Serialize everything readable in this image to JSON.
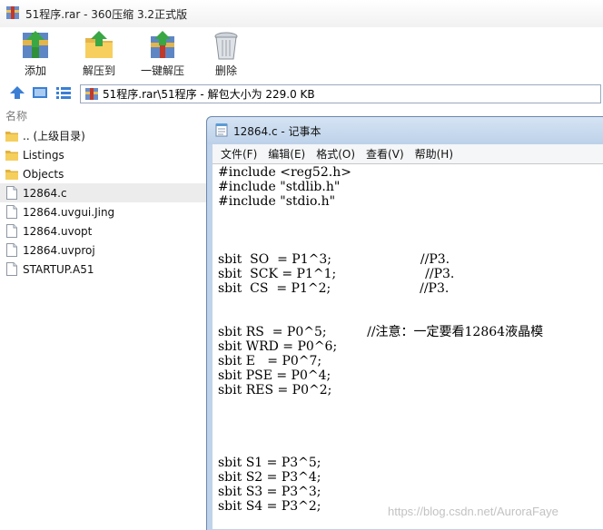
{
  "window": {
    "title": "51程序.rar - 360压缩 3.2正式版"
  },
  "toolbar": [
    {
      "label": "添加",
      "icon": "add-archive-icon"
    },
    {
      "label": "解压到",
      "icon": "extract-folder-icon"
    },
    {
      "label": "一键解压",
      "icon": "one-click-extract-icon"
    },
    {
      "label": "删除",
      "icon": "trash-icon"
    }
  ],
  "navbar": {
    "path": "51程序.rar\\51程序 - 解包大小为 229.0 KB",
    "icons": [
      "up-arrow-icon",
      "view-large-icon",
      "view-list-icon"
    ]
  },
  "filelist": {
    "header": "名称",
    "items": [
      {
        "name": ".. (上级目录)",
        "type": "folder",
        "selected": false
      },
      {
        "name": "Listings",
        "type": "folder",
        "selected": false
      },
      {
        "name": "Objects",
        "type": "folder",
        "selected": false
      },
      {
        "name": "12864.c",
        "type": "file",
        "selected": true
      },
      {
        "name": "12864.uvgui.Jing",
        "type": "file",
        "selected": false
      },
      {
        "name": "12864.uvopt",
        "type": "file",
        "selected": false
      },
      {
        "name": "12864.uvproj",
        "type": "file",
        "selected": false
      },
      {
        "name": "STARTUP.A51",
        "type": "file",
        "selected": false
      }
    ]
  },
  "notepad": {
    "title": "12864.c - 记事本",
    "menu": [
      "文件(F)",
      "编辑(E)",
      "格式(O)",
      "查看(V)",
      "帮助(H)"
    ],
    "content": "#include <reg52.h>\n#include \"stdlib.h\"\n#include \"stdio.h\"\n\n\n\nsbit  SO  = P1^3;                      //P3.\nsbit  SCK = P1^1;                      //P3.\nsbit  CS  = P1^2;                      //P3.\n\n\nsbit RS  = P0^5;          //注意：一定要看12864液晶模\nsbit WRD = P0^6;\nsbit E   = P0^7;\nsbit PSE = P0^4;\nsbit RES = P0^2;\n\n\n\n\nsbit S1 = P3^5;\nsbit S2 = P3^4;\nsbit S3 = P3^3;\nsbit S4 = P3^2;"
  },
  "watermark": "https://blog.csdn.net/AuroraFaye"
}
